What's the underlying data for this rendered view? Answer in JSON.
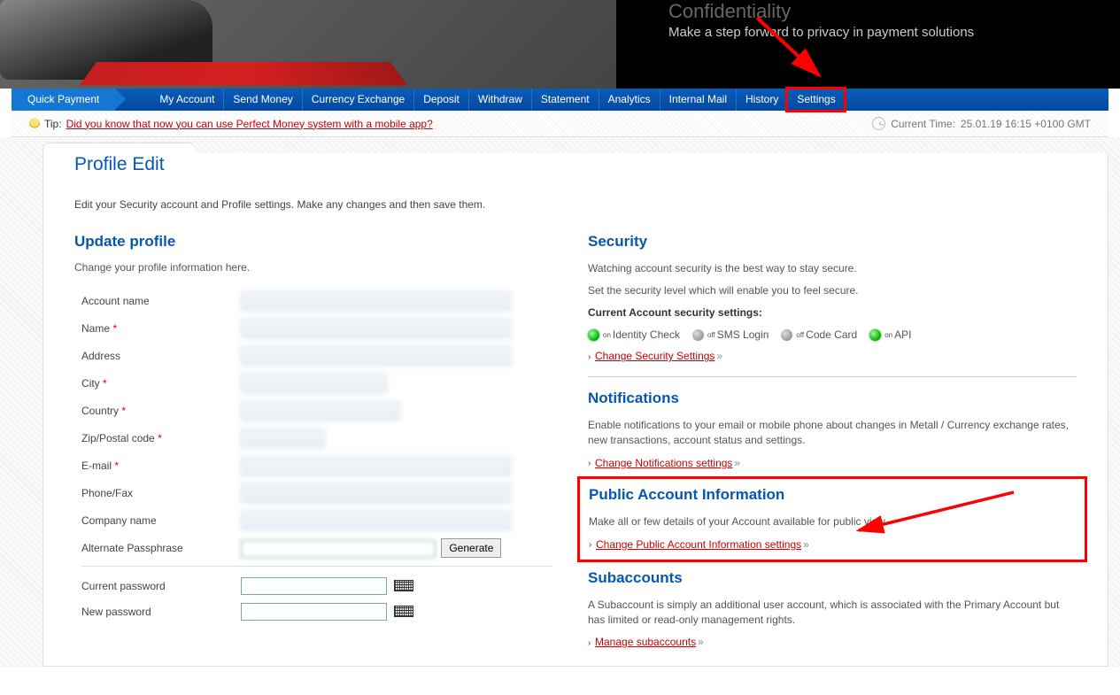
{
  "banner": {
    "title": "Confidentiality",
    "subtitle": "Make a step forward to privacy in payment solutions"
  },
  "nav": {
    "quick": "Quick Payment",
    "items": [
      "My Account",
      "Send Money",
      "Currency Exchange",
      "Deposit",
      "Withdraw",
      "Statement",
      "Analytics",
      "Internal Mail",
      "History",
      "Settings"
    ]
  },
  "infobar": {
    "tip_label": "Tip:",
    "tip_link": "Did you know that now you can use Perfect Money system with a mobile app?",
    "time_label": "Current Time:",
    "time_value": "25.01.19 16:15 +0100 GMT"
  },
  "page": {
    "tab": "Profile Edit",
    "subtitle": "Edit your Security account and Profile settings. Make any changes and then save them."
  },
  "profile": {
    "heading": "Update profile",
    "hint": "Change your profile information here.",
    "labels": {
      "account_name": "Account name",
      "name": "Name",
      "address": "Address",
      "city": "City",
      "country": "Country",
      "zip": "Zip/Postal code",
      "email": "E-mail",
      "phone": "Phone/Fax",
      "company": "Company name",
      "passphrase": "Alternate Passphrase",
      "cur_pass": "Current password",
      "new_pass": "New password"
    },
    "generate": "Generate"
  },
  "security": {
    "heading": "Security",
    "line1": "Watching account security is the best way to stay secure.",
    "line2": "Set the security level which will enable you to feel secure.",
    "current": "Current Account security settings:",
    "opts": {
      "identity": "Identity Check",
      "sms": "SMS Login",
      "code": "Code Card",
      "api": "API"
    },
    "on": "on",
    "off": "off",
    "link": "Change Security Settings"
  },
  "notifications": {
    "heading": "Notifications",
    "text": "Enable notifications to your email or mobile phone about changes in Metall / Currency exchange rates, new transactions, account status and settings.",
    "link": "Change Notifications settings"
  },
  "public": {
    "heading": "Public Account Information",
    "text": "Make all or few details of your Account available for public view",
    "link": "Change Public Account Information settings"
  },
  "subaccounts": {
    "heading": "Subaccounts",
    "text": "A Subaccount is simply an additional user account, which is associated with the Primary Account but has limited or read-only management rights.",
    "link": "Manage subaccounts"
  }
}
